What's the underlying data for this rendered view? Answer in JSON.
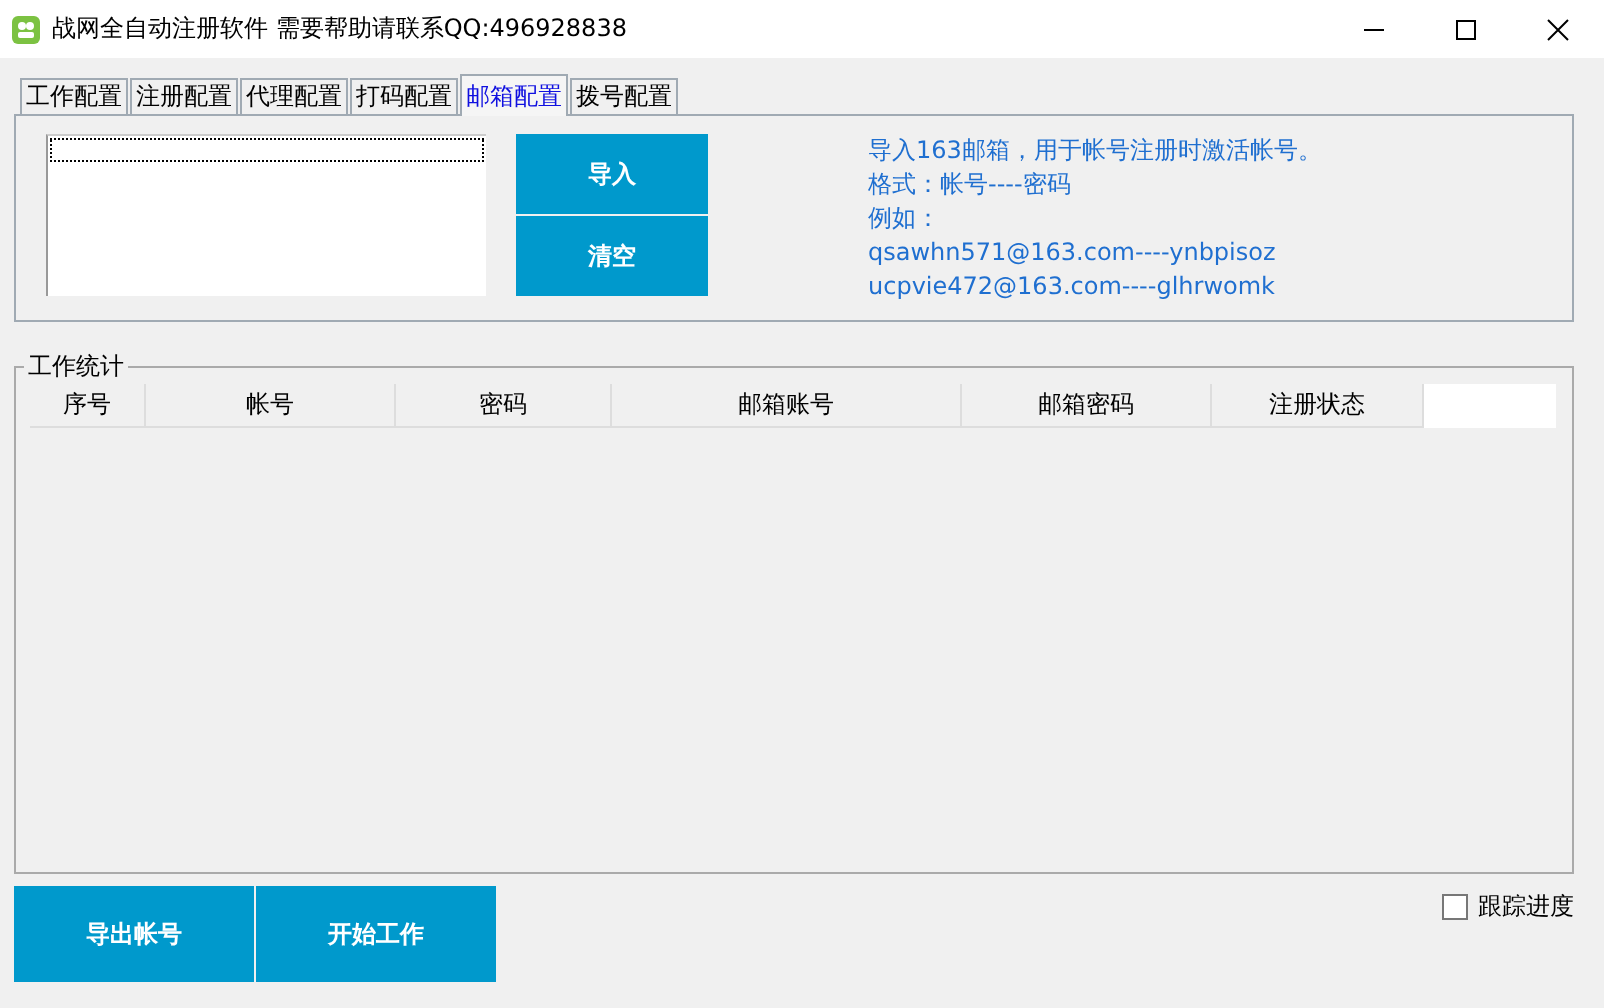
{
  "window": {
    "title": "战网全自动注册软件 需要帮助请联系QQ:496928838"
  },
  "tabs": [
    {
      "label": "工作配置",
      "selected": false
    },
    {
      "label": "注册配置",
      "selected": false
    },
    {
      "label": "代理配置",
      "selected": false
    },
    {
      "label": "打码配置",
      "selected": false
    },
    {
      "label": "邮箱配置",
      "selected": true
    },
    {
      "label": "拨号配置",
      "selected": false
    }
  ],
  "mail_panel": {
    "buttons": [
      "导入",
      "清空"
    ],
    "hint_lines": [
      "导入163邮箱，用于帐号注册时激活帐号。",
      "格式：帐号----密码",
      "例如：",
      "qsawhn571@163.com----ynbpisoz",
      "ucpvie472@163.com----glhrwomk"
    ]
  },
  "stats": {
    "title": "工作统计",
    "table": {
      "columns": [
        "序号",
        "帐号",
        "密码",
        "邮箱账号",
        "邮箱密码",
        "注册状态"
      ]
    }
  },
  "bottom_buttons": [
    "导出帐号",
    "开始工作"
  ],
  "track_progress": {
    "label": "跟踪进度",
    "checked": false
  }
}
